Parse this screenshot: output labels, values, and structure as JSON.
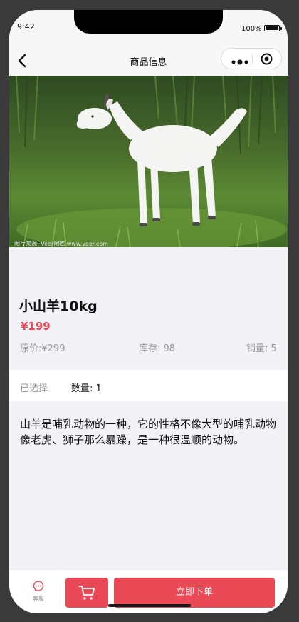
{
  "status_bar": {
    "time": "9:42",
    "battery": "100%"
  },
  "navbar": {
    "title": "商品信息"
  },
  "product": {
    "name": "小山羊10kg",
    "price": "¥199",
    "original_price": "原价:¥299",
    "stock": "库存: 98",
    "sales": "销量: 5",
    "image_watermark": "图片来源: Veer图库 www.veer.com"
  },
  "selection": {
    "label": "已选择",
    "quantity": "数量:  1"
  },
  "description": "山羊是哺乳动物的一种，它的性格不像大型的哺乳动物像老虎、狮子那么暴躁，是一种很温顺的动物。",
  "bottom_bar": {
    "service_label": "客服",
    "buy_label": "立即下单"
  },
  "colors": {
    "accent": "#ea4a55",
    "background": "#f2f2f6"
  },
  "icons": [
    "back-arrow-icon",
    "more-dots-icon",
    "target-icon",
    "chat-icon",
    "cart-icon"
  ]
}
